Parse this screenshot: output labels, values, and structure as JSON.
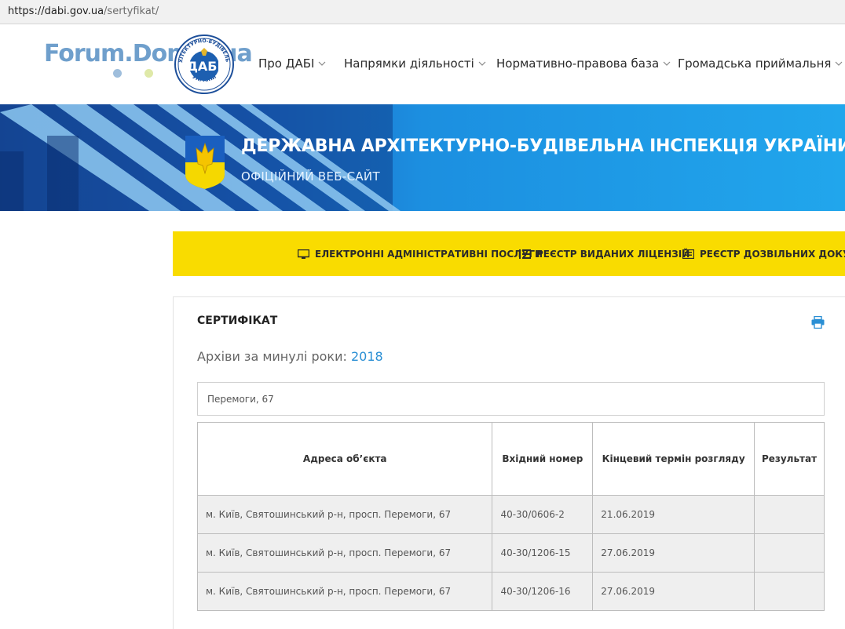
{
  "browser": {
    "url_host": "https://dabi.gov.ua",
    "url_path": "/sertyfikat/"
  },
  "header": {
    "logo_text": "Forum.Domik.ua",
    "seal_top_text": "АРХІТЕКТУРНО-БУДІВЕЛЬНА",
    "seal_center_text": "ДАБІ",
    "seal_bottom_text": "УКРАЇНИ",
    "nav": [
      {
        "label": "Про ДАБІ"
      },
      {
        "label": "Напрямки діяльності"
      },
      {
        "label": "Нормативно-правова база"
      },
      {
        "label": "Громадська приймальня"
      }
    ]
  },
  "banner": {
    "title": "ДЕРЖАВНА АРХІТЕКТУРНО-БУДІВЕЛЬНА ІНСПЕКЦІЯ УКРАЇНИ",
    "subtitle": "ОФІЦІЙНИЙ ВЕБ-САЙТ"
  },
  "services": [
    {
      "label": "ЕЛЕКТРОННІ АДМІНІСТРАТИВНІ ПОСЛУГИ",
      "icon": "monitor-icon"
    },
    {
      "label": "РЕЄСТР ВИДАНИХ ЛІЦЕНЗІЙ",
      "icon": "list-icon"
    },
    {
      "label": "РЕЄСТР ДОЗВІЛЬНИХ ДОКУМЕНТ",
      "icon": "document-icon"
    }
  ],
  "content": {
    "page_title": "СЕРТИФІКАТ",
    "archives_label": "Архіви за минулі роки:",
    "archives_year": "2018",
    "search_value": "Перемоги, 67",
    "table": {
      "columns": [
        "Адреса об’єкта",
        "Вхідний номер",
        "Кінцевий термін розгляду",
        "Результат"
      ],
      "rows": [
        [
          "м. Київ, Святошинський р-н, просп. Перемоги, 67",
          "40-30/0606-2",
          "21.06.2019",
          ""
        ],
        [
          "м. Київ, Святошинський р-н, просп. Перемоги, 67",
          "40-30/1206-15",
          "27.06.2019",
          ""
        ],
        [
          "м. Київ, Святошинський р-н, просп. Перемоги, 67",
          "40-30/1206-16",
          "27.06.2019",
          ""
        ]
      ]
    }
  },
  "colors": {
    "accent_blue": "#2a8fd4",
    "service_bar_yellow": "#f9dc00",
    "banner_blue": "#1e88dc"
  }
}
